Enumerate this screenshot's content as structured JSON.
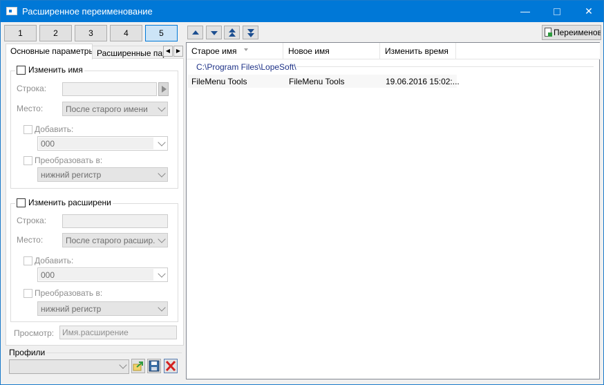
{
  "window": {
    "title": "Расширенное переименование",
    "controls": {
      "minimize": "—",
      "close": "✕"
    }
  },
  "profile_tabs": [
    "1",
    "2",
    "3",
    "4",
    "5"
  ],
  "active_profile_tab": "5",
  "settings_tabs": {
    "basic": "Основные параметры",
    "advanced": "Расширенные пара"
  },
  "group_name": {
    "checkbox_label": "Изменить имя",
    "string_label": "Строка:",
    "place_label": "Место:",
    "place_value": "После старого имени",
    "add_label": "Добавить:",
    "add_value": "000",
    "convert_label": "Преобразовать в:",
    "convert_value": "нижний регистр"
  },
  "group_ext": {
    "checkbox_label": "Изменить расширени",
    "string_label": "Строка:",
    "place_label": "Место:",
    "place_value": "После старого расшир.",
    "add_label": "Добавить:",
    "add_value": "000",
    "convert_label": "Преобразовать в:",
    "convert_value": "нижний регистр"
  },
  "preview": {
    "label": "Просмотр:",
    "value": "Имя.расширение"
  },
  "profiles": {
    "label": "Профили"
  },
  "toolbar": {
    "rename_label": "Переименовать"
  },
  "list": {
    "columns": [
      "Старое имя",
      "Новое имя",
      "Изменить время"
    ],
    "group_path": "C:\\Program Files\\LopeSoft\\",
    "rows": [
      {
        "old_name": "FileMenu Tools",
        "new_name": "FileMenu Tools",
        "modified": "19.06.2016 15:02:..."
      }
    ]
  },
  "colors": {
    "titlebar": "#0078d7",
    "active_tab": "#cce4f7",
    "group_path": "#1e3287",
    "delete_icon": "#d42020"
  }
}
